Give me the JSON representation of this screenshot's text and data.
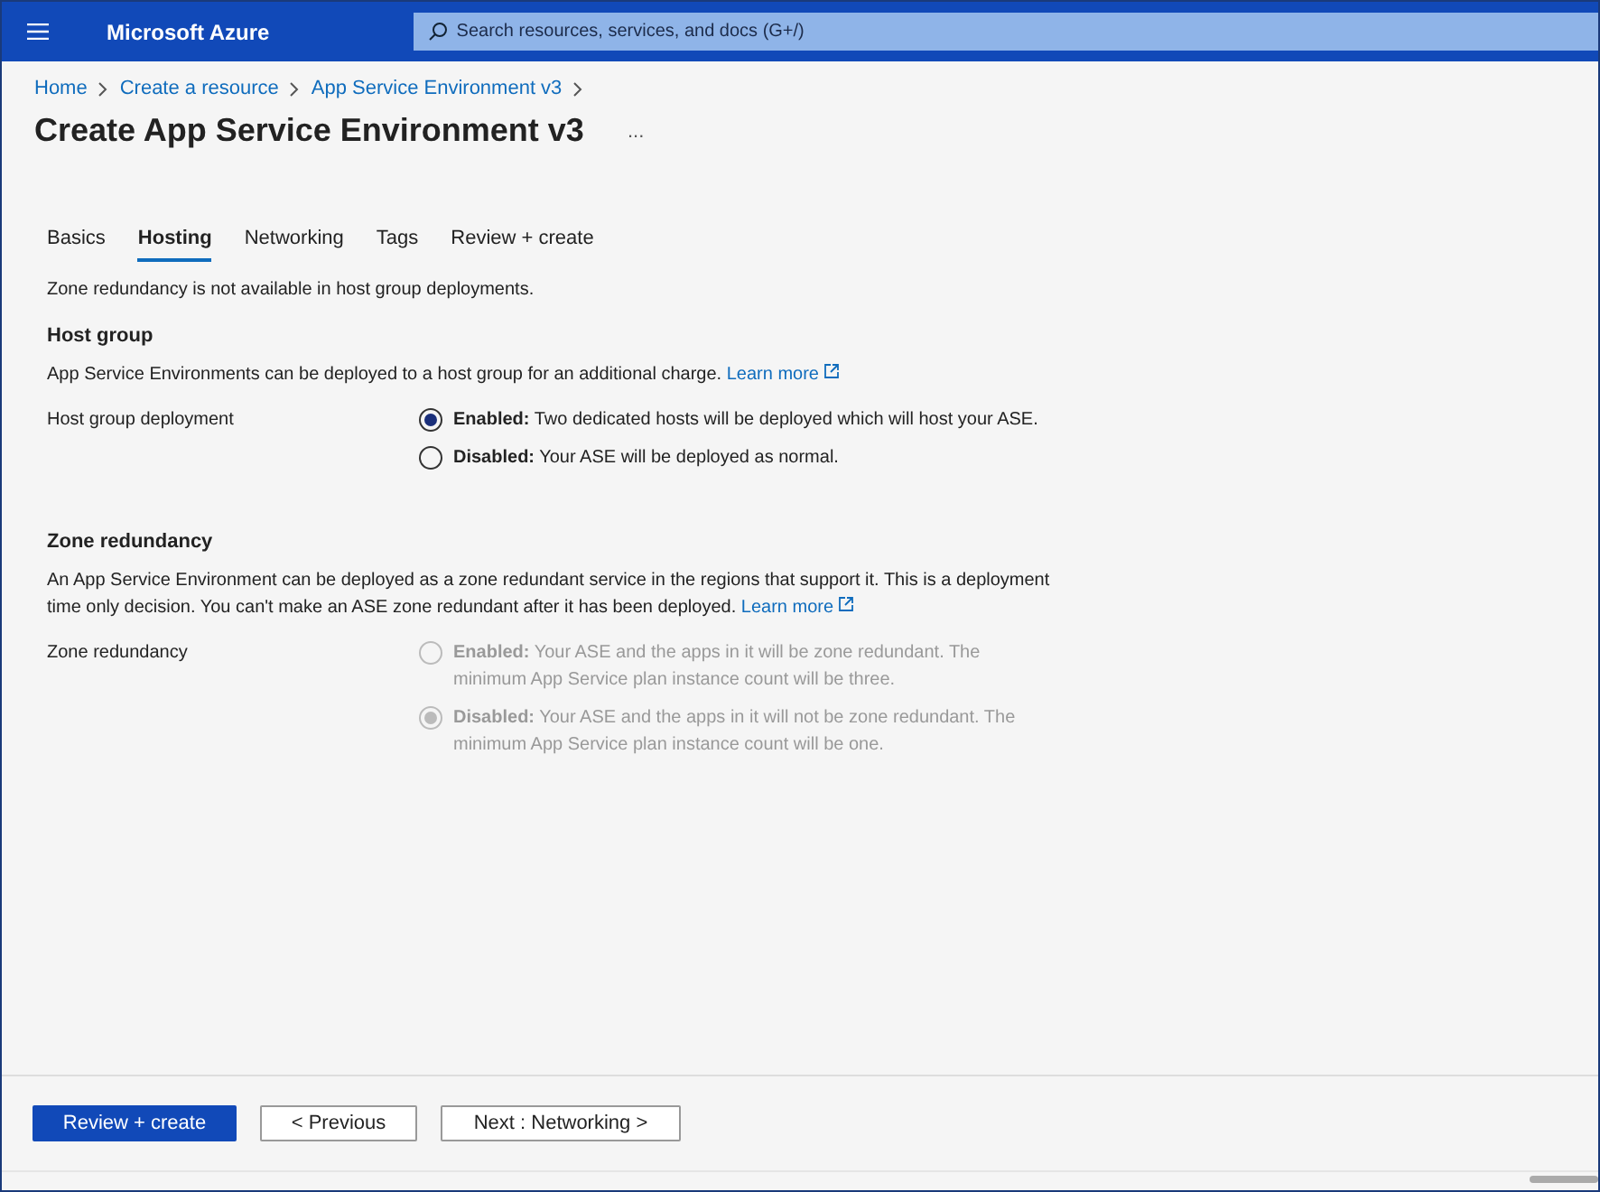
{
  "header": {
    "brand": "Microsoft Azure",
    "search": {
      "placeholder": "Search resources, services, and docs (G+/)"
    }
  },
  "breadcrumb": [
    "Home",
    "Create a resource",
    "App Service Environment v3"
  ],
  "page_title": "Create App Service Environment v3",
  "more": "...",
  "tabs": [
    {
      "label": "Basics",
      "selected": false
    },
    {
      "label": "Hosting",
      "selected": true
    },
    {
      "label": "Networking",
      "selected": false
    },
    {
      "label": "Tags",
      "selected": false
    },
    {
      "label": "Review + create",
      "selected": false
    }
  ],
  "notice": "Zone redundancy is not available in host group deployments.",
  "sections": [
    {
      "heading": "Host group",
      "description": "App Service Environments can be deployed to a host group for an additional charge.",
      "link": "Learn more",
      "field_label": "Host group deployment",
      "options": [
        {
          "text": "**Enabled:** Two dedicated hosts will be deployed which will host your ASE.",
          "selected": true,
          "disabled": false
        },
        {
          "text": "**Disabled:** Your ASE will be deployed as normal.",
          "selected": false,
          "disabled": false
        }
      ]
    },
    {
      "heading": "Zone redundancy",
      "description": "An App Service Environment can be deployed as a zone redundant service in the regions that support it. This is a deployment time only decision. You can't make an ASE zone redundant after it has been deployed.",
      "link": "Learn more",
      "field_label": "Zone redundancy",
      "options": [
        {
          "text": "**Enabled:** Your ASE and the apps in it will be zone redundant. The minimum App Service plan instance count will be three.",
          "selected": false,
          "disabled": true
        },
        {
          "text": "**Disabled:** Your ASE and the apps in it will not be zone redundant. The minimum App Service plan instance count will be one.",
          "selected": true,
          "disabled": true
        }
      ]
    }
  ],
  "footer_buttons": [
    {
      "label": "Review + create",
      "kind": "primary"
    },
    {
      "label": "< Previous",
      "kind": "secondary"
    },
    {
      "label": "Next : Networking >",
      "kind": "secondary"
    }
  ]
}
